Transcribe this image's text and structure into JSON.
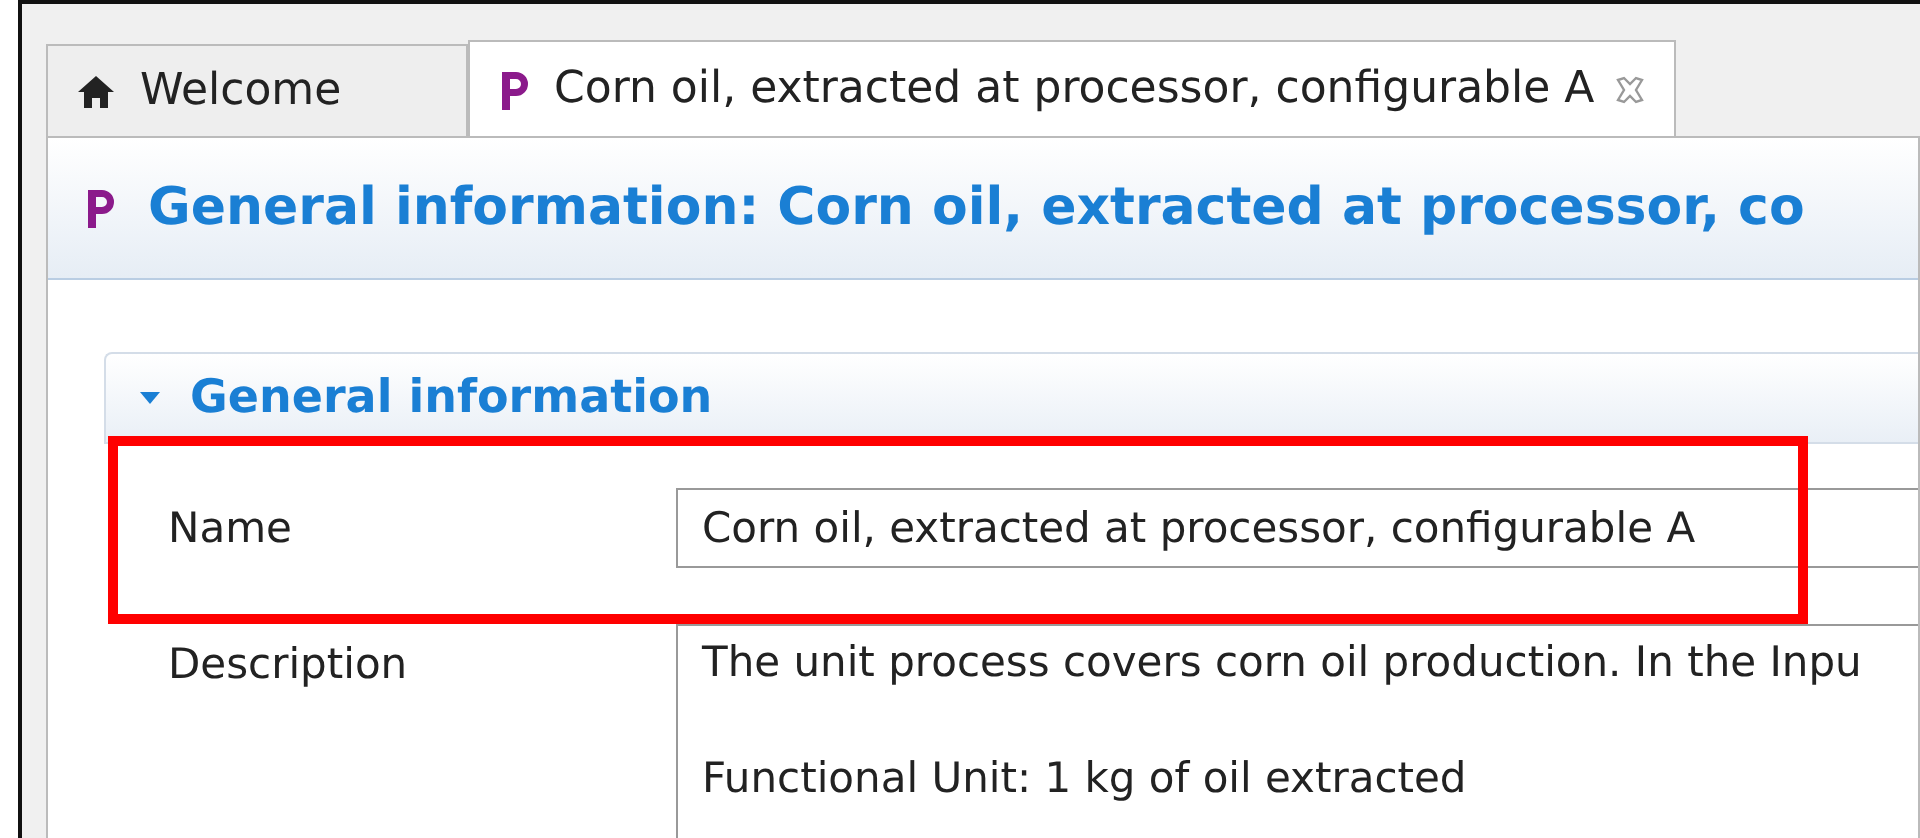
{
  "tabs": [
    {
      "label": "Welcome",
      "kind": "home",
      "selected": false
    },
    {
      "label": "Corn oil, extracted at processor, configurable A",
      "kind": "process",
      "selected": true
    }
  ],
  "editor": {
    "kind": "process",
    "title": "General information: Corn oil, extracted at processor, co"
  },
  "section": {
    "title": "General information",
    "expanded": true,
    "fields": [
      {
        "label": "Name",
        "kind": "text",
        "value": "Corn oil, extracted at processor, configurable A",
        "highlighted": true
      },
      {
        "label": "Description",
        "kind": "multiline",
        "paragraphs": [
          "The unit process covers corn oil production. In the Inpu",
          "Functional Unit: 1 kg of oil extracted"
        ],
        "highlighted": false
      }
    ]
  }
}
